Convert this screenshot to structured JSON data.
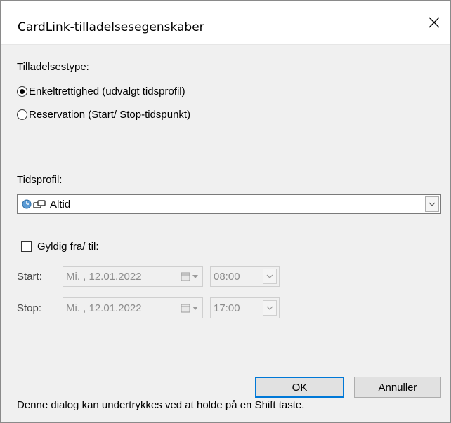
{
  "window": {
    "title": "CardLink-tilladelsesegenskaber"
  },
  "permission_type": {
    "label": "Tilladelsestype:",
    "options": [
      {
        "label": "Enkeltrettighed (udvalgt tidsprofil)",
        "selected": true
      },
      {
        "label": "Reservation (Start/ Stop-tidspunkt)",
        "selected": false
      }
    ]
  },
  "time_profile": {
    "label": "Tidsprofil:",
    "value": "Altid",
    "icons": [
      "clock-icon",
      "link-icon"
    ]
  },
  "validity": {
    "checkbox_label": "Gyldig fra/ til:",
    "checked": false,
    "start": {
      "label": "Start:",
      "date": "Mi. , 12.01.2022",
      "time": "08:00"
    },
    "stop": {
      "label": "Stop:",
      "date": "Mi. , 12.01.2022",
      "time": "17:00"
    }
  },
  "buttons": {
    "ok": "OK",
    "cancel": "Annuller"
  },
  "footer": {
    "text": "Denne dialog kan undertrykkes ved at holde på en Shift taste."
  },
  "colors": {
    "dialog_bg": "#f0f0f0",
    "accent": "#0078d7",
    "disabled_text": "#8c8c8c"
  }
}
